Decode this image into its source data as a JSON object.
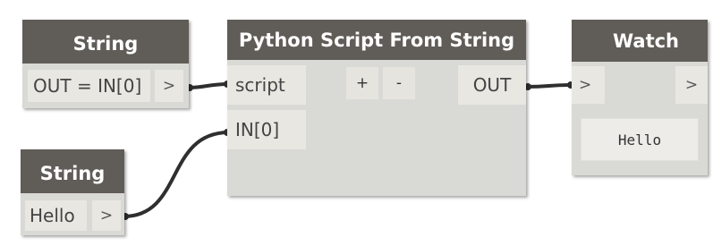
{
  "colors": {
    "node_header": "#605c57",
    "node_body": "#d9d9d5",
    "port_bg": "#e9e7e2",
    "wire": "#2f2f2f"
  },
  "nodes": {
    "string_top": {
      "title": "String",
      "value": "OUT = IN[0]",
      "out_arrow": ">"
    },
    "python": {
      "title": "Python Script From String",
      "inputs": [
        "script",
        "IN[0]"
      ],
      "add_label": "+",
      "remove_label": "-",
      "output": "OUT"
    },
    "watch": {
      "title": "Watch",
      "in_arrow": ">",
      "out_arrow": ">",
      "value": "Hello"
    },
    "string_bottom": {
      "title": "String",
      "value": "Hello",
      "out_arrow": ">"
    }
  }
}
